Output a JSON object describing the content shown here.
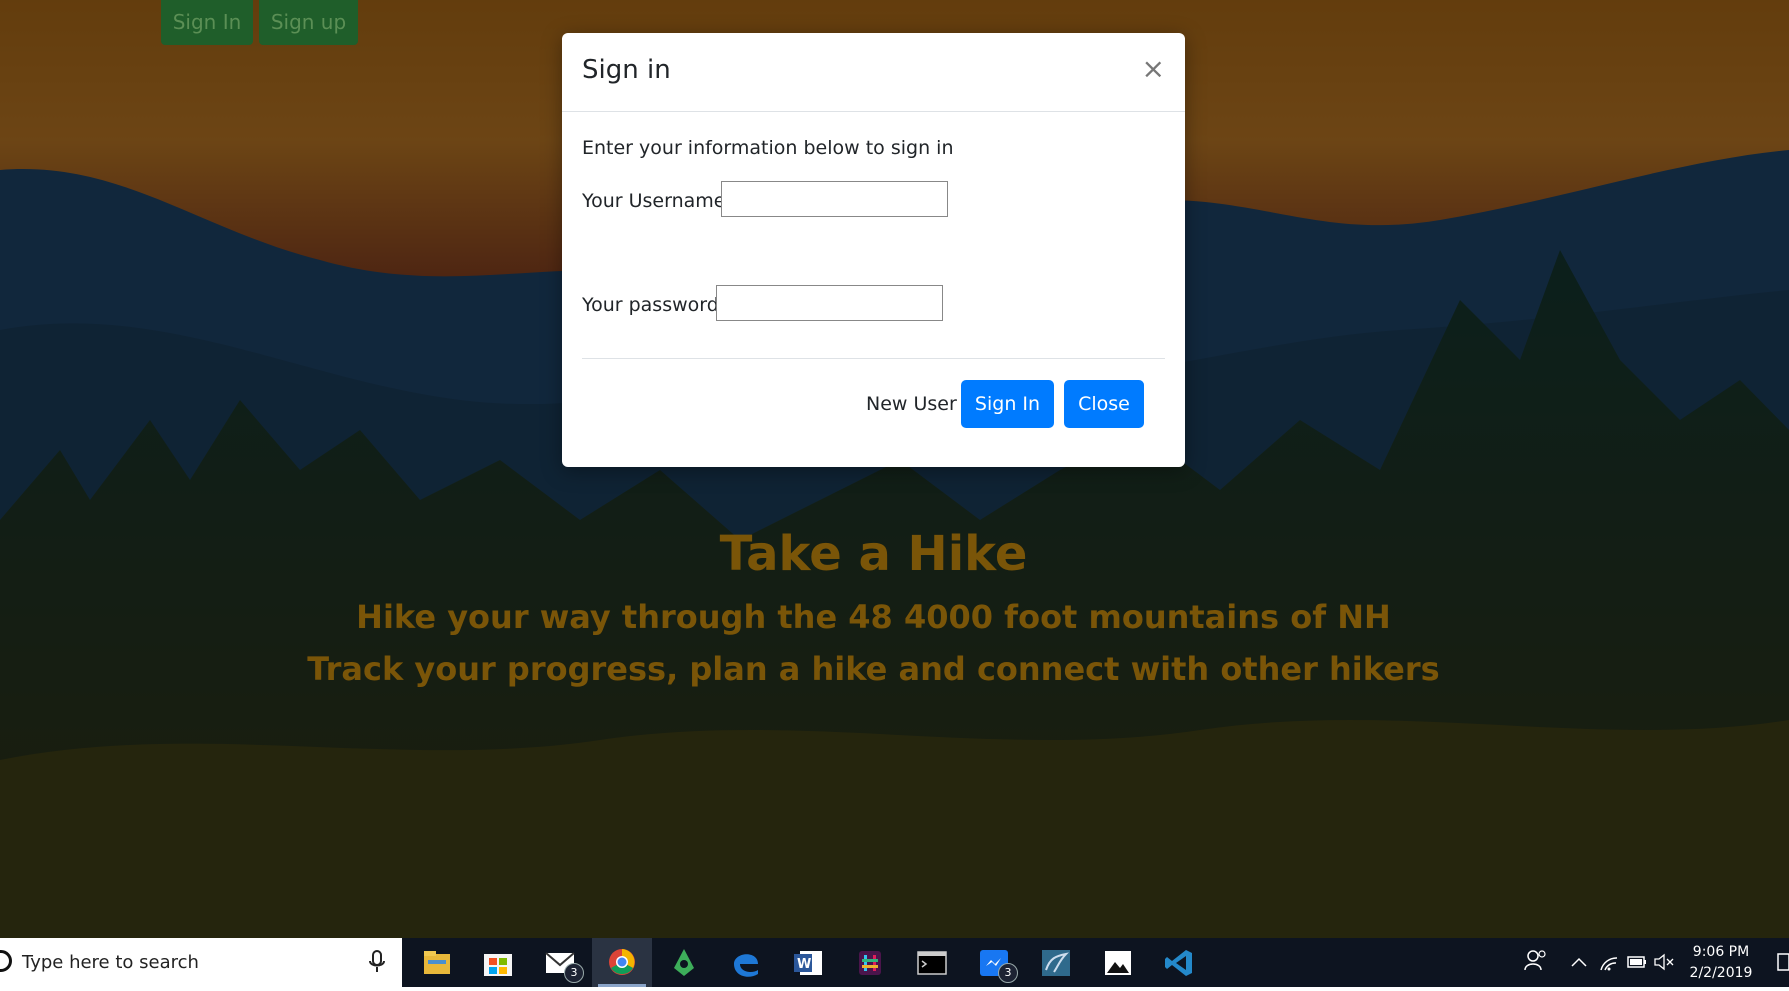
{
  "nav": {
    "signin_label": "Sign In",
    "signup_label": "Sign up"
  },
  "hero": {
    "title": "Take a Hike",
    "subtitle1": "Hike your way through the 48 4000 foot mountains of NH",
    "subtitle2": "Track your progress, plan a hike and connect with other hikers"
  },
  "modal": {
    "title": "Sign in",
    "close_glyph": "×",
    "intro": "Enter your information below to sign in",
    "username_label": "Your Username",
    "username_value": "",
    "password_label": "Your password",
    "password_value": "",
    "new_user_label": "New User",
    "signin_button": "Sign In",
    "close_button": "Close"
  },
  "taskbar": {
    "search_placeholder": "Type here to search",
    "apps": [
      {
        "name": "file-explorer-icon"
      },
      {
        "name": "microsoft-store-icon"
      },
      {
        "name": "mail-icon",
        "badge": "3"
      },
      {
        "name": "chrome-icon",
        "active": true
      },
      {
        "name": "app-icon"
      },
      {
        "name": "edge-icon"
      },
      {
        "name": "word-icon"
      },
      {
        "name": "slack-icon"
      },
      {
        "name": "terminal-icon"
      },
      {
        "name": "messenger-icon",
        "badge": "3"
      },
      {
        "name": "mysql-workbench-icon"
      },
      {
        "name": "photos-icon"
      },
      {
        "name": "vscode-icon"
      }
    ],
    "time": "9:06 PM",
    "date": "2/2/2019"
  },
  "colors": {
    "primary": "#007bff",
    "nav_button": "#1f5e2a",
    "hero_text": "#7a5508",
    "taskbar": "#0d1420"
  }
}
